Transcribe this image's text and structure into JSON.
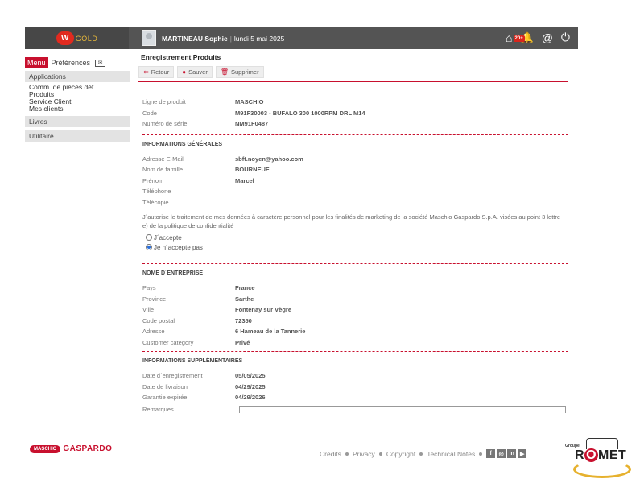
{
  "app": {
    "logo_letter": "W",
    "logo_text": "GOLD"
  },
  "user": {
    "name": "MARTINEAU Sophie",
    "separator": "|",
    "date": "lundi 5 mai 2025"
  },
  "topbar": {
    "notif_badge": "20+"
  },
  "sidebar": {
    "tabs": {
      "menu": "Menu",
      "preferences": "Préférences"
    },
    "sections": [
      {
        "title": "Applications",
        "items": [
          "Comm. de pièces dét.",
          "Produits",
          "Service Client",
          "Mes clients"
        ]
      },
      {
        "title": "Livres",
        "items": []
      },
      {
        "title": "Utilitaire",
        "items": []
      }
    ],
    "brand": {
      "maschio": "MASCHIO",
      "gaspardo": "GASPARDO"
    }
  },
  "page": {
    "title": "Enregistrement Produits",
    "toolbar": {
      "back": "Retour",
      "save": "Sauver",
      "delete": "Supprimer"
    }
  },
  "product": [
    {
      "label": "Ligne de produit",
      "value": "MASCHIO"
    },
    {
      "label": "Code",
      "value": "M91F30003 - BUFALO 300 1000RPM DRL M14"
    },
    {
      "label": "Numéro de série",
      "value": "NM91F0487"
    }
  ],
  "general": {
    "title": "INFORMATIONS GÉNÉRALES",
    "fields": [
      {
        "label": "Adresse E-Mail",
        "value": "sbft.noyen@yahoo.com"
      },
      {
        "label": "Nom de famille",
        "value": "BOURNEUF"
      },
      {
        "label": "Prénom",
        "value": "Marcel"
      },
      {
        "label": "Téléphone",
        "value": ""
      },
      {
        "label": "Télécopie",
        "value": ""
      }
    ],
    "consent_text": "J´autorise le traitement de mes données à caractère personnel pour les finalités de marketing de la société Maschio Gaspardo S.p.A. visées au point 3 lettre e) de la politique de confidentialité",
    "accept_label": "J´accepte",
    "decline_label": "Je n´accepte pas",
    "selected": "decline"
  },
  "company": {
    "title": "NOME D´ENTREPRISE",
    "fields": [
      {
        "label": "Pays",
        "value": "France"
      },
      {
        "label": "Province",
        "value": "Sarthe"
      },
      {
        "label": "Ville",
        "value": "Fontenay sur Vègre"
      },
      {
        "label": "Code postal",
        "value": "72350"
      },
      {
        "label": "Adresse",
        "value": "6 Hameau de la Tannerie"
      },
      {
        "label": "Customer category",
        "value": "Privé"
      }
    ]
  },
  "extra": {
    "title": "INFORMATIONS SUPPLÉMENTAIRES",
    "fields": [
      {
        "label": "Date d´enregistrement",
        "value": "05/05/2025"
      },
      {
        "label": "Date de livraison",
        "value": "04/29/2025"
      },
      {
        "label": "Garantie expirée",
        "value": "04/29/2026"
      }
    ],
    "remarks_label": "Remarques"
  },
  "footer": {
    "links": [
      "Credits",
      "Privacy",
      "Copyright",
      "Technical Notes"
    ]
  },
  "romet": {
    "groupe": "Groupe",
    "name_r": "R",
    "name_o": "O",
    "name_rest": "MET"
  },
  "colors": {
    "accent": "#c8102e",
    "topbar": "#545454",
    "gold": "#e8b93a"
  }
}
